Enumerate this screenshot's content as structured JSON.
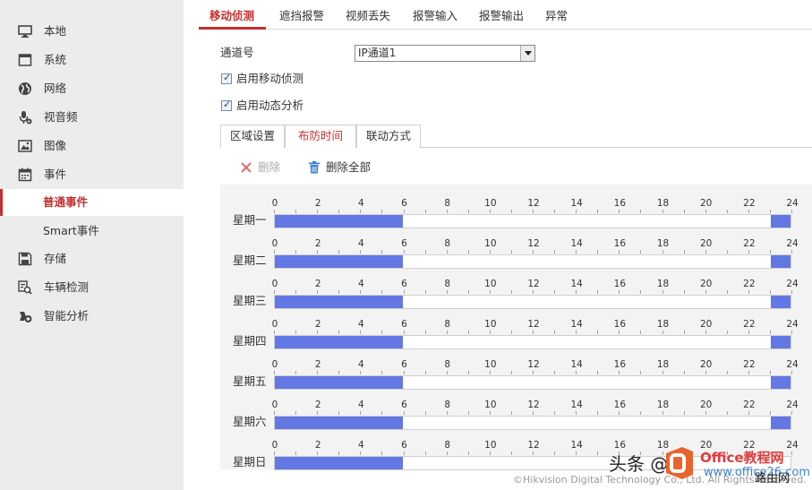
{
  "sidebar": {
    "items": [
      {
        "label": "本地",
        "icon": "monitor-icon"
      },
      {
        "label": "系统",
        "icon": "window-icon"
      },
      {
        "label": "网络",
        "icon": "globe-icon"
      },
      {
        "label": "视音频",
        "icon": "microphone-icon"
      },
      {
        "label": "图像",
        "icon": "image-icon"
      },
      {
        "label": "事件",
        "icon": "calendar-icon"
      },
      {
        "label": "普通事件",
        "icon": ""
      },
      {
        "label": "Smart事件",
        "icon": ""
      },
      {
        "label": "存储",
        "icon": "floppy-icon"
      },
      {
        "label": "车辆检测",
        "icon": "vehicle-search-icon"
      },
      {
        "label": "智能分析",
        "icon": "smart-analysis-icon"
      }
    ]
  },
  "tabs": [
    "移动侦测",
    "遮挡报警",
    "视频丢失",
    "报警输入",
    "报警输出",
    "异常"
  ],
  "form": {
    "channel_label": "通道号",
    "channel_value": "IP通道1",
    "enable_motion": "启用移动侦测",
    "enable_dynamic": "启用动态分析"
  },
  "subtabs": [
    "区域设置",
    "布防时间",
    "联动方式"
  ],
  "toolbar": {
    "delete_label": "删除",
    "delete_all_label": "删除全部"
  },
  "schedule": {
    "ticks": [
      "0",
      "2",
      "4",
      "6",
      "8",
      "10",
      "12",
      "14",
      "16",
      "18",
      "20",
      "22",
      "24"
    ],
    "days": [
      {
        "label": "星期一",
        "segments": [
          [
            0,
            6
          ],
          [
            23,
            24
          ]
        ]
      },
      {
        "label": "星期二",
        "segments": [
          [
            0,
            6
          ],
          [
            23,
            24
          ]
        ]
      },
      {
        "label": "星期三",
        "segments": [
          [
            0,
            6
          ],
          [
            23,
            24
          ]
        ]
      },
      {
        "label": "星期四",
        "segments": [
          [
            0,
            6
          ],
          [
            23,
            24
          ]
        ]
      },
      {
        "label": "星期五",
        "segments": [
          [
            0,
            6
          ],
          [
            23,
            24
          ]
        ]
      },
      {
        "label": "星期六",
        "segments": [
          [
            0,
            6
          ],
          [
            23,
            24
          ]
        ]
      },
      {
        "label": "星期日",
        "segments": [
          [
            0,
            6
          ]
        ]
      }
    ],
    "bar_color": "#6377e5"
  },
  "copyright": "©Hikvision Digital Technology Co., Ltd. All Rights Reserved.",
  "watermark": {
    "text": "头条 @",
    "site": "Office教程网",
    "site2": "www.office26.com",
    "tail": "路由网"
  },
  "colors": {
    "accent": "#c62e2e",
    "sidebar_bg": "#ececec"
  }
}
